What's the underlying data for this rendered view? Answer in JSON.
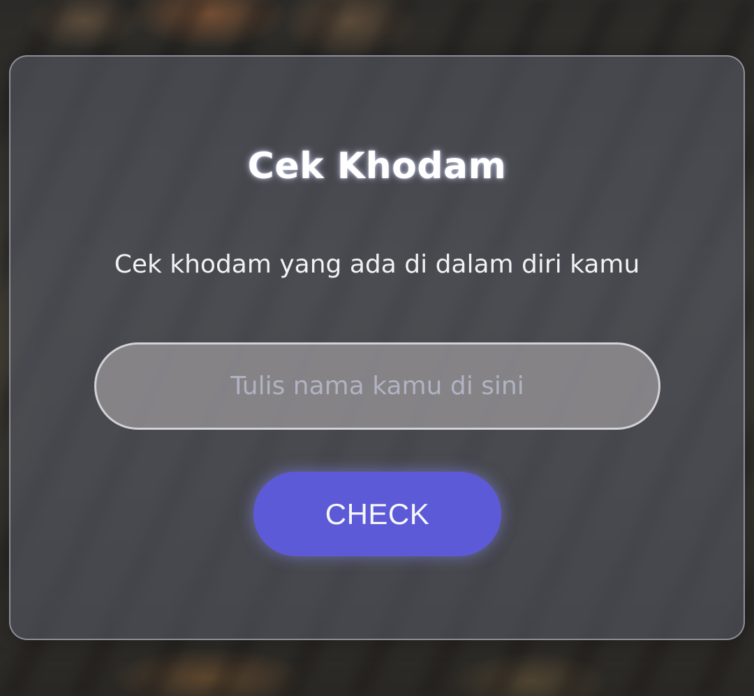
{
  "card": {
    "title": "Cek Khodam",
    "subtitle": "Cek khodam yang ada di dalam diri kamu"
  },
  "form": {
    "name_input": {
      "value": "",
      "placeholder": "Tulis nama kamu di sini"
    },
    "check_button_label": "CHECK"
  },
  "colors": {
    "accent": "#5c5ad6",
    "card_background": "#565864",
    "title_text": "#ffffff",
    "placeholder_text": "#b1b3c3"
  }
}
